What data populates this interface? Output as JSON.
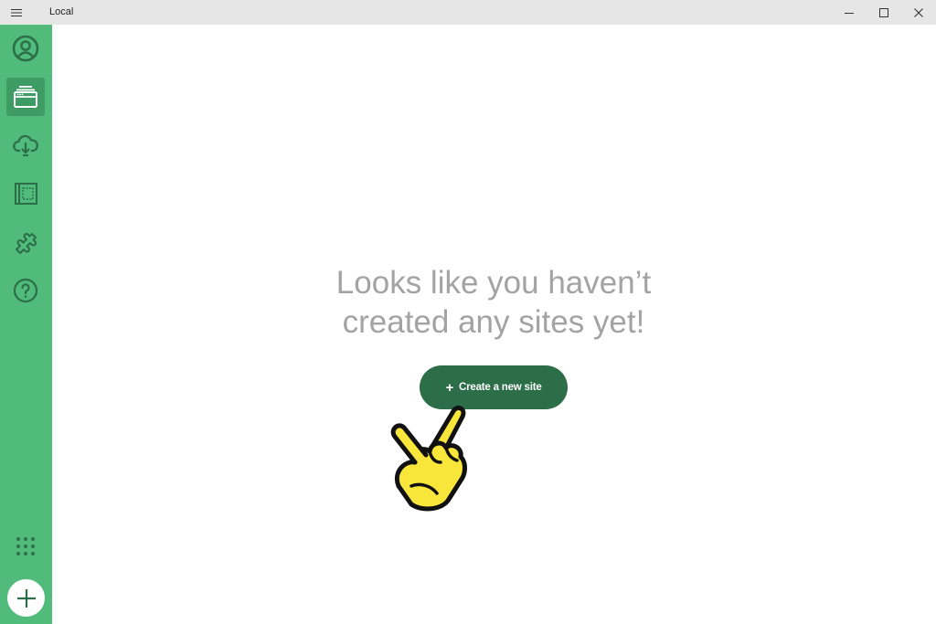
{
  "window": {
    "title": "Local",
    "controls": {
      "minimize_icon": "minimize-icon",
      "maximize_icon": "maximize-icon",
      "close_icon": "close-icon"
    }
  },
  "sidebar": {
    "items": [
      {
        "name": "account",
        "icon": "user-circle-icon",
        "active": false
      },
      {
        "name": "sites",
        "icon": "browser-window-icon",
        "active": true
      },
      {
        "name": "connect",
        "icon": "cloud-download-icon",
        "active": false
      },
      {
        "name": "blueprints",
        "icon": "blueprint-icon",
        "active": false
      },
      {
        "name": "add-ons",
        "icon": "puzzle-icon",
        "active": false
      },
      {
        "name": "help",
        "icon": "question-circle-icon",
        "active": false
      }
    ],
    "bottom": {
      "grid_icon": "dots-grid-icon",
      "add_icon": "plus-icon"
    }
  },
  "main": {
    "empty_line1": "Looks like you haven’t",
    "empty_line2": "created any sites yet!",
    "create_plus": "+",
    "create_label": "Create a new site"
  },
  "colors": {
    "sidebar": "#51bb7b",
    "sidebar_active": "#3e9b63",
    "icon": "#2b6e48",
    "button": "#2b6e48",
    "heading": "#a3a3a3",
    "titlebar": "#e6e6e6",
    "pointer_hand": "#f8e63a"
  }
}
